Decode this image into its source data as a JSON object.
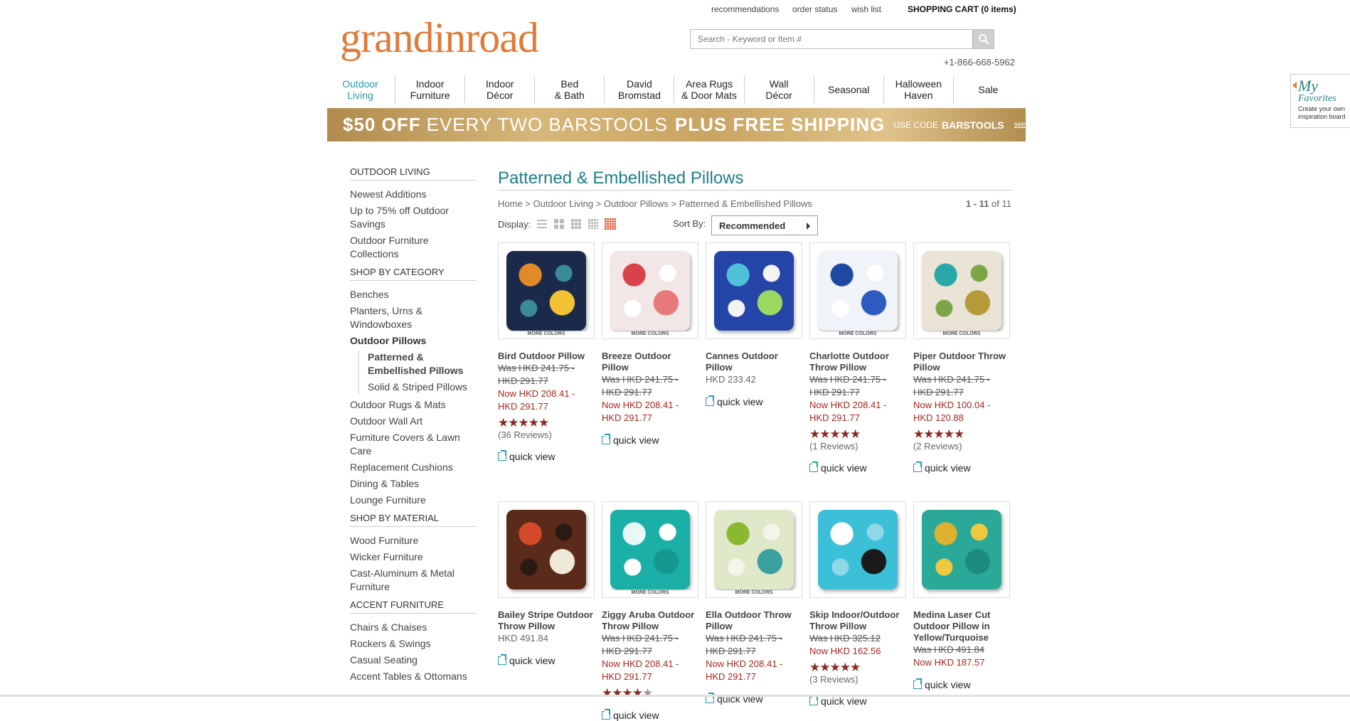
{
  "header": {
    "logo": "grandinroad",
    "links": [
      "recommendations",
      "order status",
      "wish list"
    ],
    "cart": "SHOPPING CART (0 items)",
    "search_placeholder": "Search - Keyword or Item #",
    "phone": "+1-866-668-5962"
  },
  "nav": [
    {
      "label": "Outdoor\nLiving",
      "active": true
    },
    {
      "label": "Indoor\nFurniture"
    },
    {
      "label": "Indoor\nDécor"
    },
    {
      "label": "Bed\n& Bath"
    },
    {
      "label": "David\nBromstad"
    },
    {
      "label": "Area Rugs\n& Door Mats"
    },
    {
      "label": "Wall\nDécor"
    },
    {
      "label": "Seasonal"
    },
    {
      "label": "Halloween\nHaven"
    },
    {
      "label": "Sale"
    }
  ],
  "banner": {
    "part1": "$50 OFF",
    "part2": "EVERY TWO BARSTOOLS",
    "part3": "PLUS FREE SHIPPING",
    "part4": "USE CODE",
    "code": "BARSTOOLS",
    "details": "see details"
  },
  "favorites": {
    "title": "My",
    "subtitle": "Favorites",
    "text": "Create your own inspiration board"
  },
  "sidebar": {
    "heading": "OUTDOOR LIVING",
    "top_items": [
      "Newest Additions",
      "Up to 75% off Outdoor Savings",
      "Outdoor Furniture Collections"
    ],
    "category_heading": "SHOP BY CATEGORY",
    "category_items_a": [
      "Benches",
      "Planters, Urns & Windowboxes"
    ],
    "current_category": "Outdoor Pillows",
    "sub_items": [
      "Patterned & Embellished Pillows",
      "Solid & Striped Pillows"
    ],
    "category_items_b": [
      "Outdoor Rugs & Mats",
      "Outdoor Wall Art",
      "Furniture Covers & Lawn Care",
      "Replacement Cushions",
      "Dining & Tables",
      "Lounge Furniture"
    ],
    "material_heading": "SHOP BY MATERIAL",
    "material_items": [
      "Wood Furniture",
      "Wicker Furniture",
      "Cast-Aluminum & Metal Furniture"
    ],
    "accent_heading": "ACCENT FURNITURE",
    "accent_items": [
      "Chairs & Chaises",
      "Rockers & Swings",
      "Casual Seating",
      "Accent Tables & Ottomans"
    ]
  },
  "main": {
    "title": "Patterned & Embellished Pillows",
    "breadcrumb": "Home > Outdoor Living > Outdoor Pillows > Patterned & Embellished Pillows",
    "count_range": "1 - 11",
    "count_of": "of 11",
    "display_label": "Display:",
    "sort_label": "Sort By:",
    "sort_value": "Recommended",
    "more_colors": "MORE COLORS",
    "quick_view": "quick view"
  },
  "products": [
    {
      "name": "Bird Outdoor Pillow",
      "was": "Was HKD 241.75 - HKD 291.77",
      "now": "Now HKD 208.41 - HKD 291.77",
      "stars": 5,
      "reviews": "(36 Reviews)",
      "more": true,
      "colors": [
        "#1b2a4a",
        "#e08a2a",
        "#f2c232",
        "#3a8b9a"
      ]
    },
    {
      "name": "Breeze Outdoor Pillow",
      "was": "Was HKD 241.75 - HKD 291.77",
      "now": "Now HKD 208.41 - HKD 291.77",
      "more": true,
      "colors": [
        "#f3e6e6",
        "#d8424a",
        "#e67a7a",
        "#fff"
      ]
    },
    {
      "name": "Cannes Outdoor Pillow",
      "price": "HKD 233.42",
      "colors": [
        "#2444a8",
        "#4fc0d8",
        "#9bd860",
        "#f3f3f3"
      ]
    },
    {
      "name": "Charlotte Outdoor Throw Pillow",
      "was": "Was HKD 241.75 - HKD 291.77",
      "now": "Now HKD 208.41 - HKD 291.77",
      "stars": 5,
      "reviews": "(1 Reviews)",
      "more": true,
      "colors": [
        "#f0f3f8",
        "#1f48a0",
        "#2c5cc0",
        "#ffffff"
      ]
    },
    {
      "name": "Piper Outdoor Throw Pillow",
      "was": "Was HKD 241.75 - HKD 291.77",
      "now": "Now HKD 100.04 - HKD 120.88",
      "stars": 4.5,
      "reviews": "(2 Reviews)",
      "more": true,
      "colors": [
        "#e9e4d6",
        "#2aa8a8",
        "#b59a3a",
        "#7da548"
      ]
    },
    {
      "name": "Bailey Stripe Outdoor Throw Pillow",
      "price": "HKD 491.84",
      "colors": [
        "#5a2a1a",
        "#d44a2a",
        "#f0e8d8",
        "#2a1a12"
      ]
    },
    {
      "name": "Ziggy Aruba Outdoor Throw Pillow",
      "was": "Was HKD 241.75 - HKD 291.77",
      "now": "Now HKD 208.41 - HKD 291.77",
      "stars": 4,
      "more": true,
      "colors": [
        "#1ab0a8",
        "#e8f8f6",
        "#14988f",
        "#ffffff"
      ]
    },
    {
      "name": "Ella Outdoor Throw Pillow",
      "was": "Was HKD 241.75 - HKD 291.77",
      "now": "Now HKD 208.41 - HKD 291.77",
      "more": true,
      "colors": [
        "#dfe8c8",
        "#8ab830",
        "#3aa0a0",
        "#f4f4ea"
      ]
    },
    {
      "name": "Skip Indoor/Outdoor Throw Pillow",
      "was": "Was HKD 325.12",
      "now": "Now HKD 162.56",
      "stars": 5,
      "reviews": "(3 Reviews)",
      "colors": [
        "#3cc0d8",
        "#ffffff",
        "#1a1a1a",
        "#8fd8e8"
      ]
    },
    {
      "name": "Medina Laser Cut Outdoor Pillow in Yellow/Turquoise",
      "was": "Was HKD 491.84",
      "now": "Now HKD 187.57",
      "colors": [
        "#2aa898",
        "#e0b030",
        "#1c8c80",
        "#f0c840"
      ]
    }
  ]
}
